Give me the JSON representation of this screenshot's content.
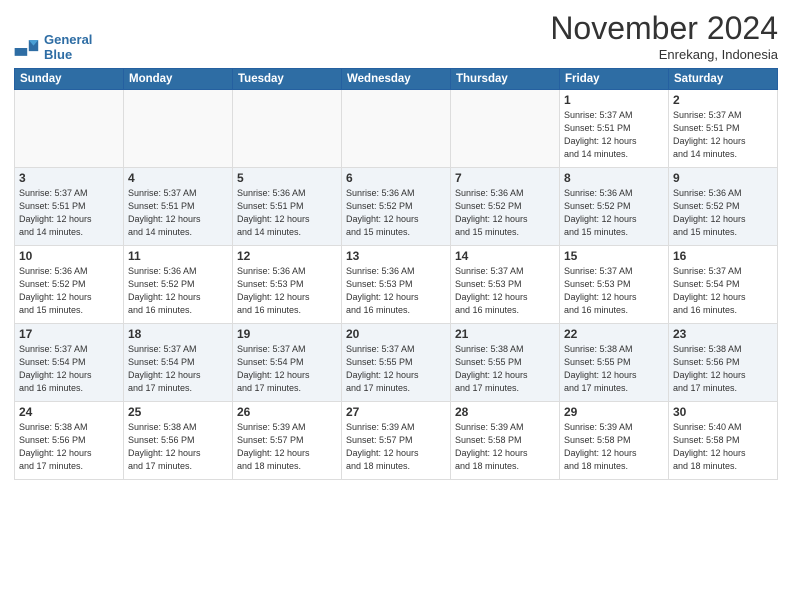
{
  "header": {
    "logo_line1": "General",
    "logo_line2": "Blue",
    "month": "November 2024",
    "location": "Enrekang, Indonesia"
  },
  "weekdays": [
    "Sunday",
    "Monday",
    "Tuesday",
    "Wednesday",
    "Thursday",
    "Friday",
    "Saturday"
  ],
  "weeks": [
    [
      {
        "day": "",
        "info": ""
      },
      {
        "day": "",
        "info": ""
      },
      {
        "day": "",
        "info": ""
      },
      {
        "day": "",
        "info": ""
      },
      {
        "day": "",
        "info": ""
      },
      {
        "day": "1",
        "info": "Sunrise: 5:37 AM\nSunset: 5:51 PM\nDaylight: 12 hours\nand 14 minutes."
      },
      {
        "day": "2",
        "info": "Sunrise: 5:37 AM\nSunset: 5:51 PM\nDaylight: 12 hours\nand 14 minutes."
      }
    ],
    [
      {
        "day": "3",
        "info": "Sunrise: 5:37 AM\nSunset: 5:51 PM\nDaylight: 12 hours\nand 14 minutes."
      },
      {
        "day": "4",
        "info": "Sunrise: 5:37 AM\nSunset: 5:51 PM\nDaylight: 12 hours\nand 14 minutes."
      },
      {
        "day": "5",
        "info": "Sunrise: 5:36 AM\nSunset: 5:51 PM\nDaylight: 12 hours\nand 14 minutes."
      },
      {
        "day": "6",
        "info": "Sunrise: 5:36 AM\nSunset: 5:52 PM\nDaylight: 12 hours\nand 15 minutes."
      },
      {
        "day": "7",
        "info": "Sunrise: 5:36 AM\nSunset: 5:52 PM\nDaylight: 12 hours\nand 15 minutes."
      },
      {
        "day": "8",
        "info": "Sunrise: 5:36 AM\nSunset: 5:52 PM\nDaylight: 12 hours\nand 15 minutes."
      },
      {
        "day": "9",
        "info": "Sunrise: 5:36 AM\nSunset: 5:52 PM\nDaylight: 12 hours\nand 15 minutes."
      }
    ],
    [
      {
        "day": "10",
        "info": "Sunrise: 5:36 AM\nSunset: 5:52 PM\nDaylight: 12 hours\nand 15 minutes."
      },
      {
        "day": "11",
        "info": "Sunrise: 5:36 AM\nSunset: 5:52 PM\nDaylight: 12 hours\nand 16 minutes."
      },
      {
        "day": "12",
        "info": "Sunrise: 5:36 AM\nSunset: 5:53 PM\nDaylight: 12 hours\nand 16 minutes."
      },
      {
        "day": "13",
        "info": "Sunrise: 5:36 AM\nSunset: 5:53 PM\nDaylight: 12 hours\nand 16 minutes."
      },
      {
        "day": "14",
        "info": "Sunrise: 5:37 AM\nSunset: 5:53 PM\nDaylight: 12 hours\nand 16 minutes."
      },
      {
        "day": "15",
        "info": "Sunrise: 5:37 AM\nSunset: 5:53 PM\nDaylight: 12 hours\nand 16 minutes."
      },
      {
        "day": "16",
        "info": "Sunrise: 5:37 AM\nSunset: 5:54 PM\nDaylight: 12 hours\nand 16 minutes."
      }
    ],
    [
      {
        "day": "17",
        "info": "Sunrise: 5:37 AM\nSunset: 5:54 PM\nDaylight: 12 hours\nand 16 minutes."
      },
      {
        "day": "18",
        "info": "Sunrise: 5:37 AM\nSunset: 5:54 PM\nDaylight: 12 hours\nand 17 minutes."
      },
      {
        "day": "19",
        "info": "Sunrise: 5:37 AM\nSunset: 5:54 PM\nDaylight: 12 hours\nand 17 minutes."
      },
      {
        "day": "20",
        "info": "Sunrise: 5:37 AM\nSunset: 5:55 PM\nDaylight: 12 hours\nand 17 minutes."
      },
      {
        "day": "21",
        "info": "Sunrise: 5:38 AM\nSunset: 5:55 PM\nDaylight: 12 hours\nand 17 minutes."
      },
      {
        "day": "22",
        "info": "Sunrise: 5:38 AM\nSunset: 5:55 PM\nDaylight: 12 hours\nand 17 minutes."
      },
      {
        "day": "23",
        "info": "Sunrise: 5:38 AM\nSunset: 5:56 PM\nDaylight: 12 hours\nand 17 minutes."
      }
    ],
    [
      {
        "day": "24",
        "info": "Sunrise: 5:38 AM\nSunset: 5:56 PM\nDaylight: 12 hours\nand 17 minutes."
      },
      {
        "day": "25",
        "info": "Sunrise: 5:38 AM\nSunset: 5:56 PM\nDaylight: 12 hours\nand 17 minutes."
      },
      {
        "day": "26",
        "info": "Sunrise: 5:39 AM\nSunset: 5:57 PM\nDaylight: 12 hours\nand 18 minutes."
      },
      {
        "day": "27",
        "info": "Sunrise: 5:39 AM\nSunset: 5:57 PM\nDaylight: 12 hours\nand 18 minutes."
      },
      {
        "day": "28",
        "info": "Sunrise: 5:39 AM\nSunset: 5:58 PM\nDaylight: 12 hours\nand 18 minutes."
      },
      {
        "day": "29",
        "info": "Sunrise: 5:39 AM\nSunset: 5:58 PM\nDaylight: 12 hours\nand 18 minutes."
      },
      {
        "day": "30",
        "info": "Sunrise: 5:40 AM\nSunset: 5:58 PM\nDaylight: 12 hours\nand 18 minutes."
      }
    ]
  ]
}
